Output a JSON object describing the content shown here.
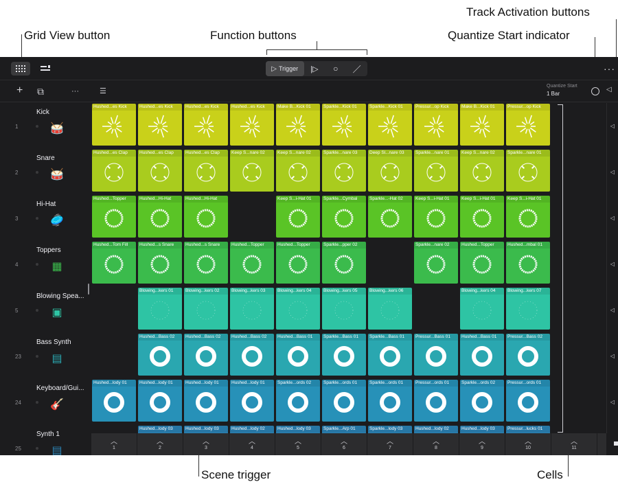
{
  "callouts": {
    "grid_view": "Grid View button",
    "function_buttons": "Function buttons",
    "track_activation": "Track Activation buttons",
    "quantize_start": "Quantize Start indicator",
    "scene_trigger": "Scene trigger",
    "cells": "Cells"
  },
  "toolbar": {
    "trigger_label": "Trigger",
    "more": "···"
  },
  "quantize": {
    "label": "Quantize Start",
    "value": "1 Bar"
  },
  "colors": {
    "yellow": "#c9d11a",
    "lime": "#9ccc1f",
    "green": "#52c225",
    "green2": "#34b84a",
    "teal": "#2ec4a4",
    "teal2": "#2aa7b0",
    "blue": "#2791b8"
  },
  "tracks": [
    {
      "num": "1",
      "name": "Kick",
      "icon": "kick-drum-icon",
      "glyph": "🥁",
      "color": "#c9d11a",
      "cells": [
        "Hushed...es Kick",
        "Hushed...es Kick",
        "Hushed...es Kick",
        "Hushed...es Kick",
        "Make B...Kick 01",
        "Sparkle...Kick 01",
        "Sparkle...Kick 01",
        "Pressur...op Kick",
        "Make B...Kick 01",
        "Pressur...op Kick"
      ]
    },
    {
      "num": "2",
      "name": "Snare",
      "icon": "snare-drum-icon",
      "glyph": "🥁",
      "color": "#a9cc1e",
      "cells": [
        "Hushed...es Clap",
        "Hushed...es Clap",
        "Hushed...es Clap",
        "Keep S...nare 02",
        "Keep S...nare 02",
        "Sparkle...nare 03",
        "Deep Sl...nare 03",
        "Sparkle...nare 01",
        "Keep S...nare 02",
        "Sparkle...nare 01"
      ]
    },
    {
      "num": "3",
      "name": "Hi-Hat",
      "icon": "hi-hat-icon",
      "glyph": "🥏",
      "color": "#5ac426",
      "cells": [
        "Hushed...Topper",
        "Hushed...Hi-Hat",
        "Hushed...Hi-Hat",
        "",
        "Keep S...i-Hat 01",
        "Sparkle...Cymbal",
        "Sparkle...-Hat 02",
        "Keep S...i-Hat 01",
        "Keep S...i-Hat 01",
        "Keep S...i-Hat 01"
      ]
    },
    {
      "num": "4",
      "name": "Toppers",
      "icon": "drum-machine-icon",
      "glyph": "▦",
      "color": "#3bbb4c",
      "cells": [
        "Hushed...Tom Fill",
        "Hushed...s Snare",
        "Hushed...s Snare",
        "Hushed...Topper",
        "Hushed...Topper",
        "Sparkle...pper 02",
        "",
        "Sparkle...nare 02",
        "Hushed...Topper",
        "Hushed...mbal 01"
      ]
    },
    {
      "num": "5",
      "name": "Blowing Spea...",
      "icon": "sampler-icon",
      "glyph": "▣",
      "color": "#2ec4a4",
      "cells": [
        "",
        "Blowing...kers 01",
        "Blowing...kers 02",
        "Blowing...kers 03",
        "Blowing...kers 04",
        "Blowing...kers 05",
        "Blowing...kers 06",
        "",
        "Blowing...kers 04",
        "Blowing...kers 07"
      ]
    },
    {
      "num": "23",
      "name": "Bass Synth",
      "icon": "synth-icon",
      "glyph": "▤",
      "color": "#2aa7b0",
      "cells": [
        "",
        "Hushed...Bass 02",
        "Hushed...Bass 02",
        "Hushed...Bass 02",
        "Hushed...Bass 01",
        "Sparkle...Bass 01",
        "Sparkle...Bass 01",
        "Pressur...Bass 01",
        "Hushed...Bass 01",
        "Pressur...Bass 02"
      ]
    },
    {
      "num": "24",
      "name": "Keyboard/Gui...",
      "icon": "guitar-icon",
      "glyph": "🎸",
      "color": "#2791b8",
      "cells": [
        "Hushed...lody 01",
        "Hushed...lody 01",
        "Hushed...lody 01",
        "Hushed...lody 01",
        "Sparkle...ords 02",
        "Sparkle...ords 01",
        "Sparkle...ords 01",
        "Pressur...ords 01",
        "Sparkle...ords 02",
        "Pressur...ords 01"
      ]
    },
    {
      "num": "25",
      "name": "Synth 1",
      "icon": "keyboard-icon",
      "glyph": "▤",
      "color": "#2b82b3",
      "cells": [
        "",
        "Hushed...lody 03",
        "Hushed...lody 03",
        "Hushed...lody 02",
        "Hushed...lody 03",
        "Sparkle...Arp 01",
        "Sparkle...lody 03",
        "Hushed...lody 02",
        "Hushed...lody 03",
        "Pressur...lucks 01"
      ]
    }
  ],
  "scenes": [
    "1",
    "2",
    "3",
    "4",
    "5",
    "6",
    "7",
    "8",
    "9",
    "10",
    "11"
  ]
}
